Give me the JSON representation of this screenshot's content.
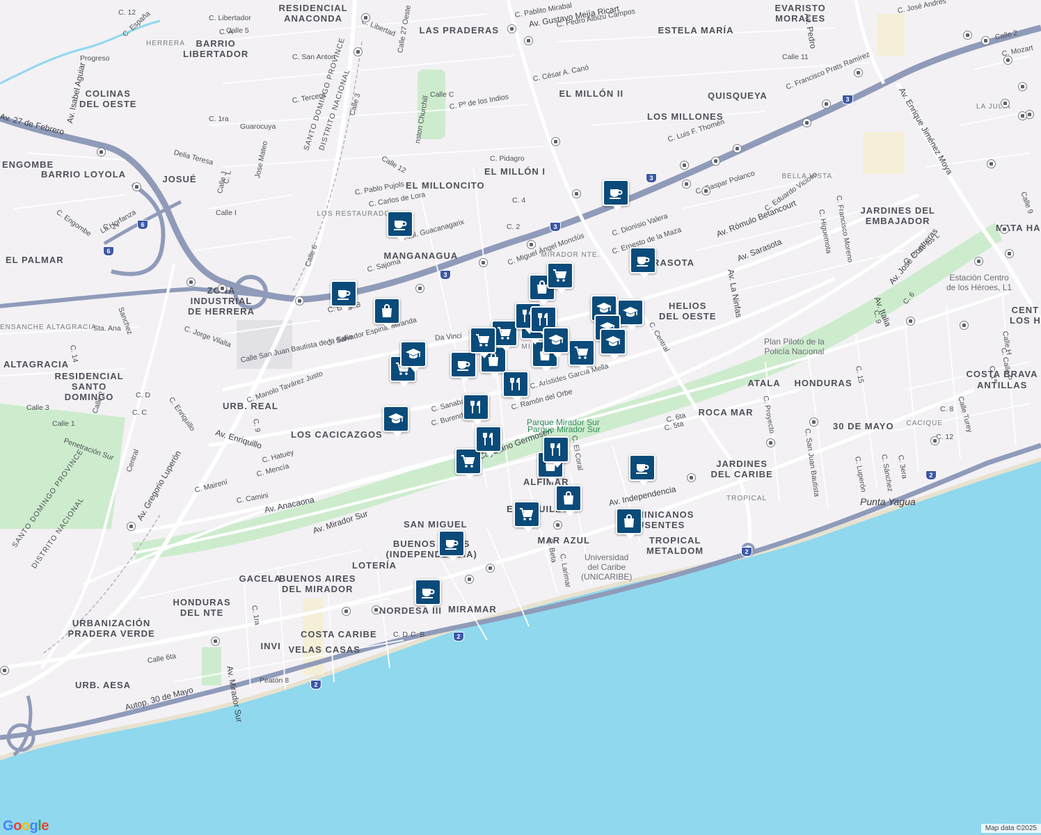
{
  "map": {
    "attribution": "Map data ©2025",
    "logo": "Google",
    "colors": {
      "land": "#f3f1f4",
      "water": "#8fd8ee",
      "park": "#cdeccd",
      "highway": "#8f9bb9",
      "arterial": "#ffffff",
      "pin": "#0b4b7a"
    },
    "districts": [
      "RESIDENCIAL\nANACONDA",
      "LAS PRADERAS",
      "ESTELA MARÍA",
      "EVARISTO\nMORALES",
      "BARRIO\nLIBERTADOR",
      "COLINAS\nDEL OESTE",
      "QUISQUEYA",
      "EL MILLÓN II",
      "LOS MILLONES",
      "ENGOMBE",
      "BARRIO LOYOLA",
      "JOSUÉ",
      "EL MILLONCITO",
      "EL MILLÓN I",
      "MANGANAGUA",
      "JARDINES DEL\nEMBAJADOR",
      "MATA HA",
      "SARASOTA",
      "EL PALMAR",
      "ZONA\nINDUSTRIAL\nDE HERRERA",
      "HELIOS\nDEL OESTE",
      "CENT\nLOS H",
      "RESIDENCIAL\nSANTO\nDOMINGO",
      "ALTAGRACIA",
      "URB. REAL",
      "ATALA",
      "HONDURAS",
      "COSTA BRAVA",
      "ANTILLAS",
      "LOS CACICAZGOS",
      "ROCA MAR",
      "30 DE MAYO",
      "JARDINES\nDEL CARIBE",
      "ALFIMAR",
      "ENRIQUILLO",
      "SAN MIGUEL",
      "BUENOS AIRES\n(INDEPENDENCIA)",
      "LOTERÍA",
      "MAR AZUL",
      "TROPICAL\nMETALDOM",
      "GACELA",
      "BUENOS AIRES\nDEL MIRADOR",
      "HONDURAS\nDEL NTE",
      "NORDESA III",
      "MIRAMAR",
      "URBANIZACIÓN\nPRADERA VERDE",
      "COSTA CARIBE",
      "INVI",
      "VELAS CASAS",
      "URB. AESA",
      "DOMINICANOS\nAUSENTES",
      "MIRADOR NTE.",
      "MI",
      "LA JULIA",
      "ENSANCHE\nALTAGRACIA",
      "HERRERA",
      "LOS RESTAURADORES",
      "BELLA VISTA",
      "CACIQUE",
      "TROPICAL"
    ],
    "streets": [
      "Av. 27 de Febrero",
      "Av. Rómulo Betancourt",
      "Av. Enriquillo",
      "Av. Anacaona",
      "Av. Mirador Sur",
      "Av. Cayetano Germosén",
      "Av. Independencia",
      "Autop. 30 de Mayo",
      "Av. Isabel Aguiar",
      "Av. Gregorio Luperón",
      "Av. Enrique Jiménez Moya",
      "Av. José Contreras",
      "Av. Sarasota",
      "Av. Italia",
      "C. Luis F. Thomén",
      "C. Francisco Prats Ramírez",
      "C. Gaspar Polanco",
      "C. Pedro Albizu Campos",
      "Av. Gustavo Mejía Ricart",
      "C. Pablito Mirabal",
      "C. Libertad",
      "C. Libertador",
      "C. San Anton",
      "Calle 5",
      "C. A",
      "C. España",
      "Progreso",
      "C. 12",
      "C. Tercera",
      "C. 1ra",
      "Guarocuya",
      "Delia Teresa",
      "Jose Mateo",
      "Calle J",
      "C. L",
      "Calle I",
      "C. Pablo Pujols",
      "C. Carlos de Lora",
      "C. Pidagro",
      "C. 4",
      "C. 2",
      "Prol. Guacanagarix",
      "C. Sajoma",
      "C. Diag. B",
      "C. Salvador Espinal Miranda",
      "Calle San Juan Bautista de la Salle",
      "C. Jorge Vilalta",
      "C. Manolo Tavárez Justo",
      "C. Hatuey",
      "C. Mencía",
      "C. Mairení",
      "C. Camini",
      "C. Sanabacoa",
      "C. Burende",
      "C. Ramón del Orbe",
      "C. Arístides García Mella",
      "C. Ernesto de la Maza",
      "C. Dionisio Valera",
      "C. Eduardo Vicioso",
      "C. Higuemota",
      "C. Francisco Moreno",
      "C. Proyecto",
      "C. San Juan Bautista",
      "C. Luperón",
      "C. Sánchez",
      "C. 3era",
      "Calle Turey",
      "C. 8",
      "C. 12",
      "C. Beta",
      "C. Larimar",
      "C. El Coral",
      "C. 6ta",
      "C. 5ta",
      "Calle 6ta",
      "Peatón 8",
      "C. 1ra",
      "Calle 3",
      "Calle 1",
      "Calle 2",
      "Penetración Sur",
      "C. Enriquillo",
      "C. D",
      "C. C",
      "C. 9",
      "Sanchez",
      "Sta. Ana",
      "C. 14",
      "C. 2ª",
      "C. Engombe",
      "La Horfanza",
      "C. 15",
      "C. 9",
      "C. 6",
      "Calle H",
      "C. Central",
      "Av. La Ninfas",
      "C. Miguel Ángel Monclús",
      "Da Vinci",
      "Central",
      "C. B",
      "C. D",
      "Calle 11",
      "C. César A. Canó",
      "C. Pº de los Indios",
      "Calle C",
      "Calle 27 Oeste",
      "Calle 3",
      "Calle 6",
      "Calle 12",
      "Calle 9",
      "Calle 2",
      "C. Mozart",
      "C. José Andrés",
      "Av. Pedro",
      "C. Pº de los L",
      "nston Churchill",
      "Av. Mirador Sur",
      "C. Calle P",
      "C. 1ª",
      "Calle H",
      "C. F"
    ],
    "parks": [
      "Parque Mirador Sur",
      "Parque Mirador Sur"
    ],
    "pois": [
      "Plan Piloto de la\nPolicía Nacional",
      "Universidad\ndel Caribe\n(UNICARIBE)",
      "Estación Centro\nde los Héroes, L1"
    ],
    "places": [
      "Punta Yagua"
    ],
    "boundaries": [
      "SANTO DOMINGO PROVINCE",
      "DISTRITO NACIONAL",
      "SANTO DOMINGO PROVINCE",
      "DISTRITO NACIONAL"
    ],
    "route_shields": [
      "3",
      "3",
      "3",
      "3",
      "6",
      "6",
      "2",
      "2",
      "2",
      "2"
    ],
    "markers": [
      {
        "type": "coffee"
      },
      {
        "type": "coffee"
      },
      {
        "type": "coffee"
      },
      {
        "type": "coffee"
      },
      {
        "type": "coffee"
      },
      {
        "type": "coffee"
      },
      {
        "type": "coffee"
      },
      {
        "type": "coffee"
      },
      {
        "type": "shopping"
      },
      {
        "type": "shopping"
      },
      {
        "type": "shopping"
      },
      {
        "type": "shopping"
      },
      {
        "type": "shopping"
      },
      {
        "type": "shopping"
      },
      {
        "type": "shopping"
      },
      {
        "type": "grocery"
      },
      {
        "type": "grocery"
      },
      {
        "type": "grocery"
      },
      {
        "type": "grocery"
      },
      {
        "type": "grocery"
      },
      {
        "type": "grocery"
      },
      {
        "type": "grocery"
      },
      {
        "type": "grocery"
      },
      {
        "type": "restaurant"
      },
      {
        "type": "restaurant"
      },
      {
        "type": "restaurant"
      },
      {
        "type": "restaurant"
      },
      {
        "type": "restaurant"
      },
      {
        "type": "restaurant"
      },
      {
        "type": "school"
      },
      {
        "type": "school"
      },
      {
        "type": "school"
      },
      {
        "type": "school"
      },
      {
        "type": "school"
      },
      {
        "type": "school"
      },
      {
        "type": "school"
      }
    ]
  }
}
